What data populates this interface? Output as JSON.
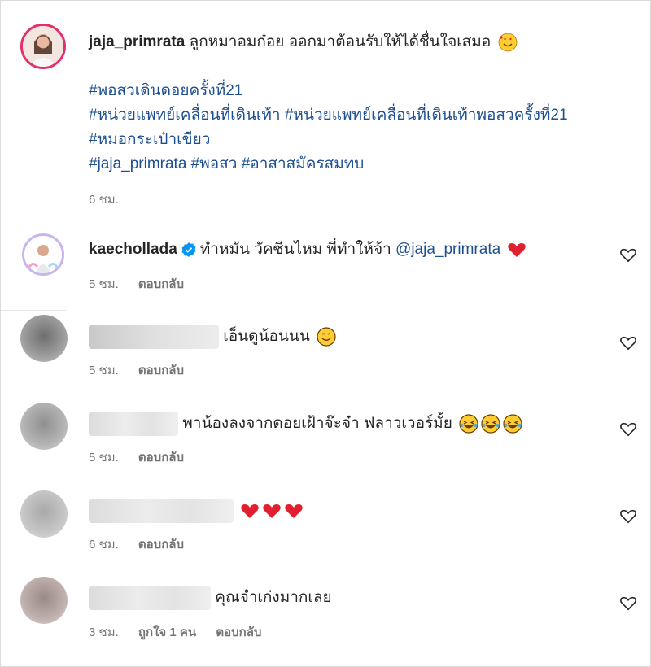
{
  "caption": {
    "username": "jaja_primrata",
    "text": "ลูกหมาอมก๋อย ออกมาต้อนรับให้ได้ชื่นใจเสมอ",
    "hashtags_line1": "#พอสวเดินดอยครั้งที่21",
    "hashtags_line2": "#หน่วยแพทย์เคลื่อนที่เดินเท้า #หน่วยแพทย์เคลื่อนที่เดินเท้าพอสวครั้งที่21 #หมอกระเป๋าเขียว",
    "hashtags_line3": "#jaja_primrata #พอสว #อาสาสมัครสมทบ",
    "time": "6 ชม."
  },
  "comments": [
    {
      "username": "kaechollada",
      "verified": true,
      "text": "ทำหมัน วัคซีนไหม พี่ทำให้จ้า",
      "mention": "@jaja_primrata",
      "time": "5 ชม.",
      "reply": "ตอบกลับ"
    },
    {
      "text": "เอ็นดูน้อนนน",
      "time": "5 ชม.",
      "reply": "ตอบกลับ"
    },
    {
      "text": "พาน้องลงจากดอยเฝ้าจ๊ะจ๋า ฟลาวเวอร์มั้ย",
      "time": "5 ชม.",
      "reply": "ตอบกลับ"
    },
    {
      "text": "",
      "time": "6 ชม.",
      "reply": "ตอบกลับ"
    },
    {
      "text": "คุณจำเก่งมากเลย",
      "time": "3 ชม.",
      "likes": "ถูกใจ 1 คน",
      "reply": "ตอบกลับ"
    }
  ],
  "colors": {
    "hashtag": "#1d4f91",
    "muted": "#737373",
    "heart_red": "#e0202f",
    "verified_blue": "#0095f6"
  }
}
